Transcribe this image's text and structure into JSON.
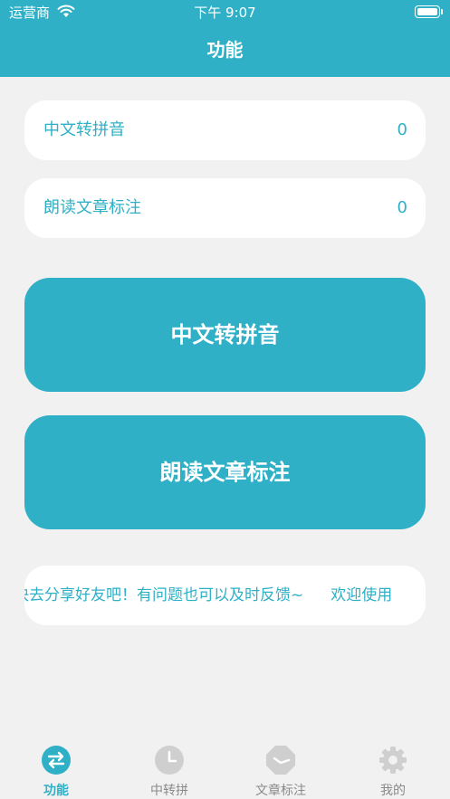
{
  "status_bar": {
    "carrier": "运营商",
    "time": "下午 9:07"
  },
  "header": {
    "title": "功能"
  },
  "rows": [
    {
      "label": "中文转拼音",
      "count": "0"
    },
    {
      "label": "朗读文章标注",
      "count": "0"
    }
  ],
  "buttons": {
    "pinyin_label": "中文转拼音",
    "annotate_label": "朗读文章标注"
  },
  "marquee": {
    "text": "快去分享好友吧！有问题也可以及时反馈~",
    "text_repeat": "欢迎使用"
  },
  "tabs": [
    {
      "label": "功能",
      "icon": "swap-arrows-icon",
      "active": true
    },
    {
      "label": "中转拼",
      "icon": "clock-icon",
      "active": false
    },
    {
      "label": "文章标注",
      "icon": "octagon-clock-icon",
      "active": false
    },
    {
      "label": "我的",
      "icon": "gear-icon",
      "active": false
    }
  ],
  "colors": {
    "accent": "#2fb0c6",
    "background": "#f1f1f1",
    "inactive_icon": "#cfcfcf"
  }
}
